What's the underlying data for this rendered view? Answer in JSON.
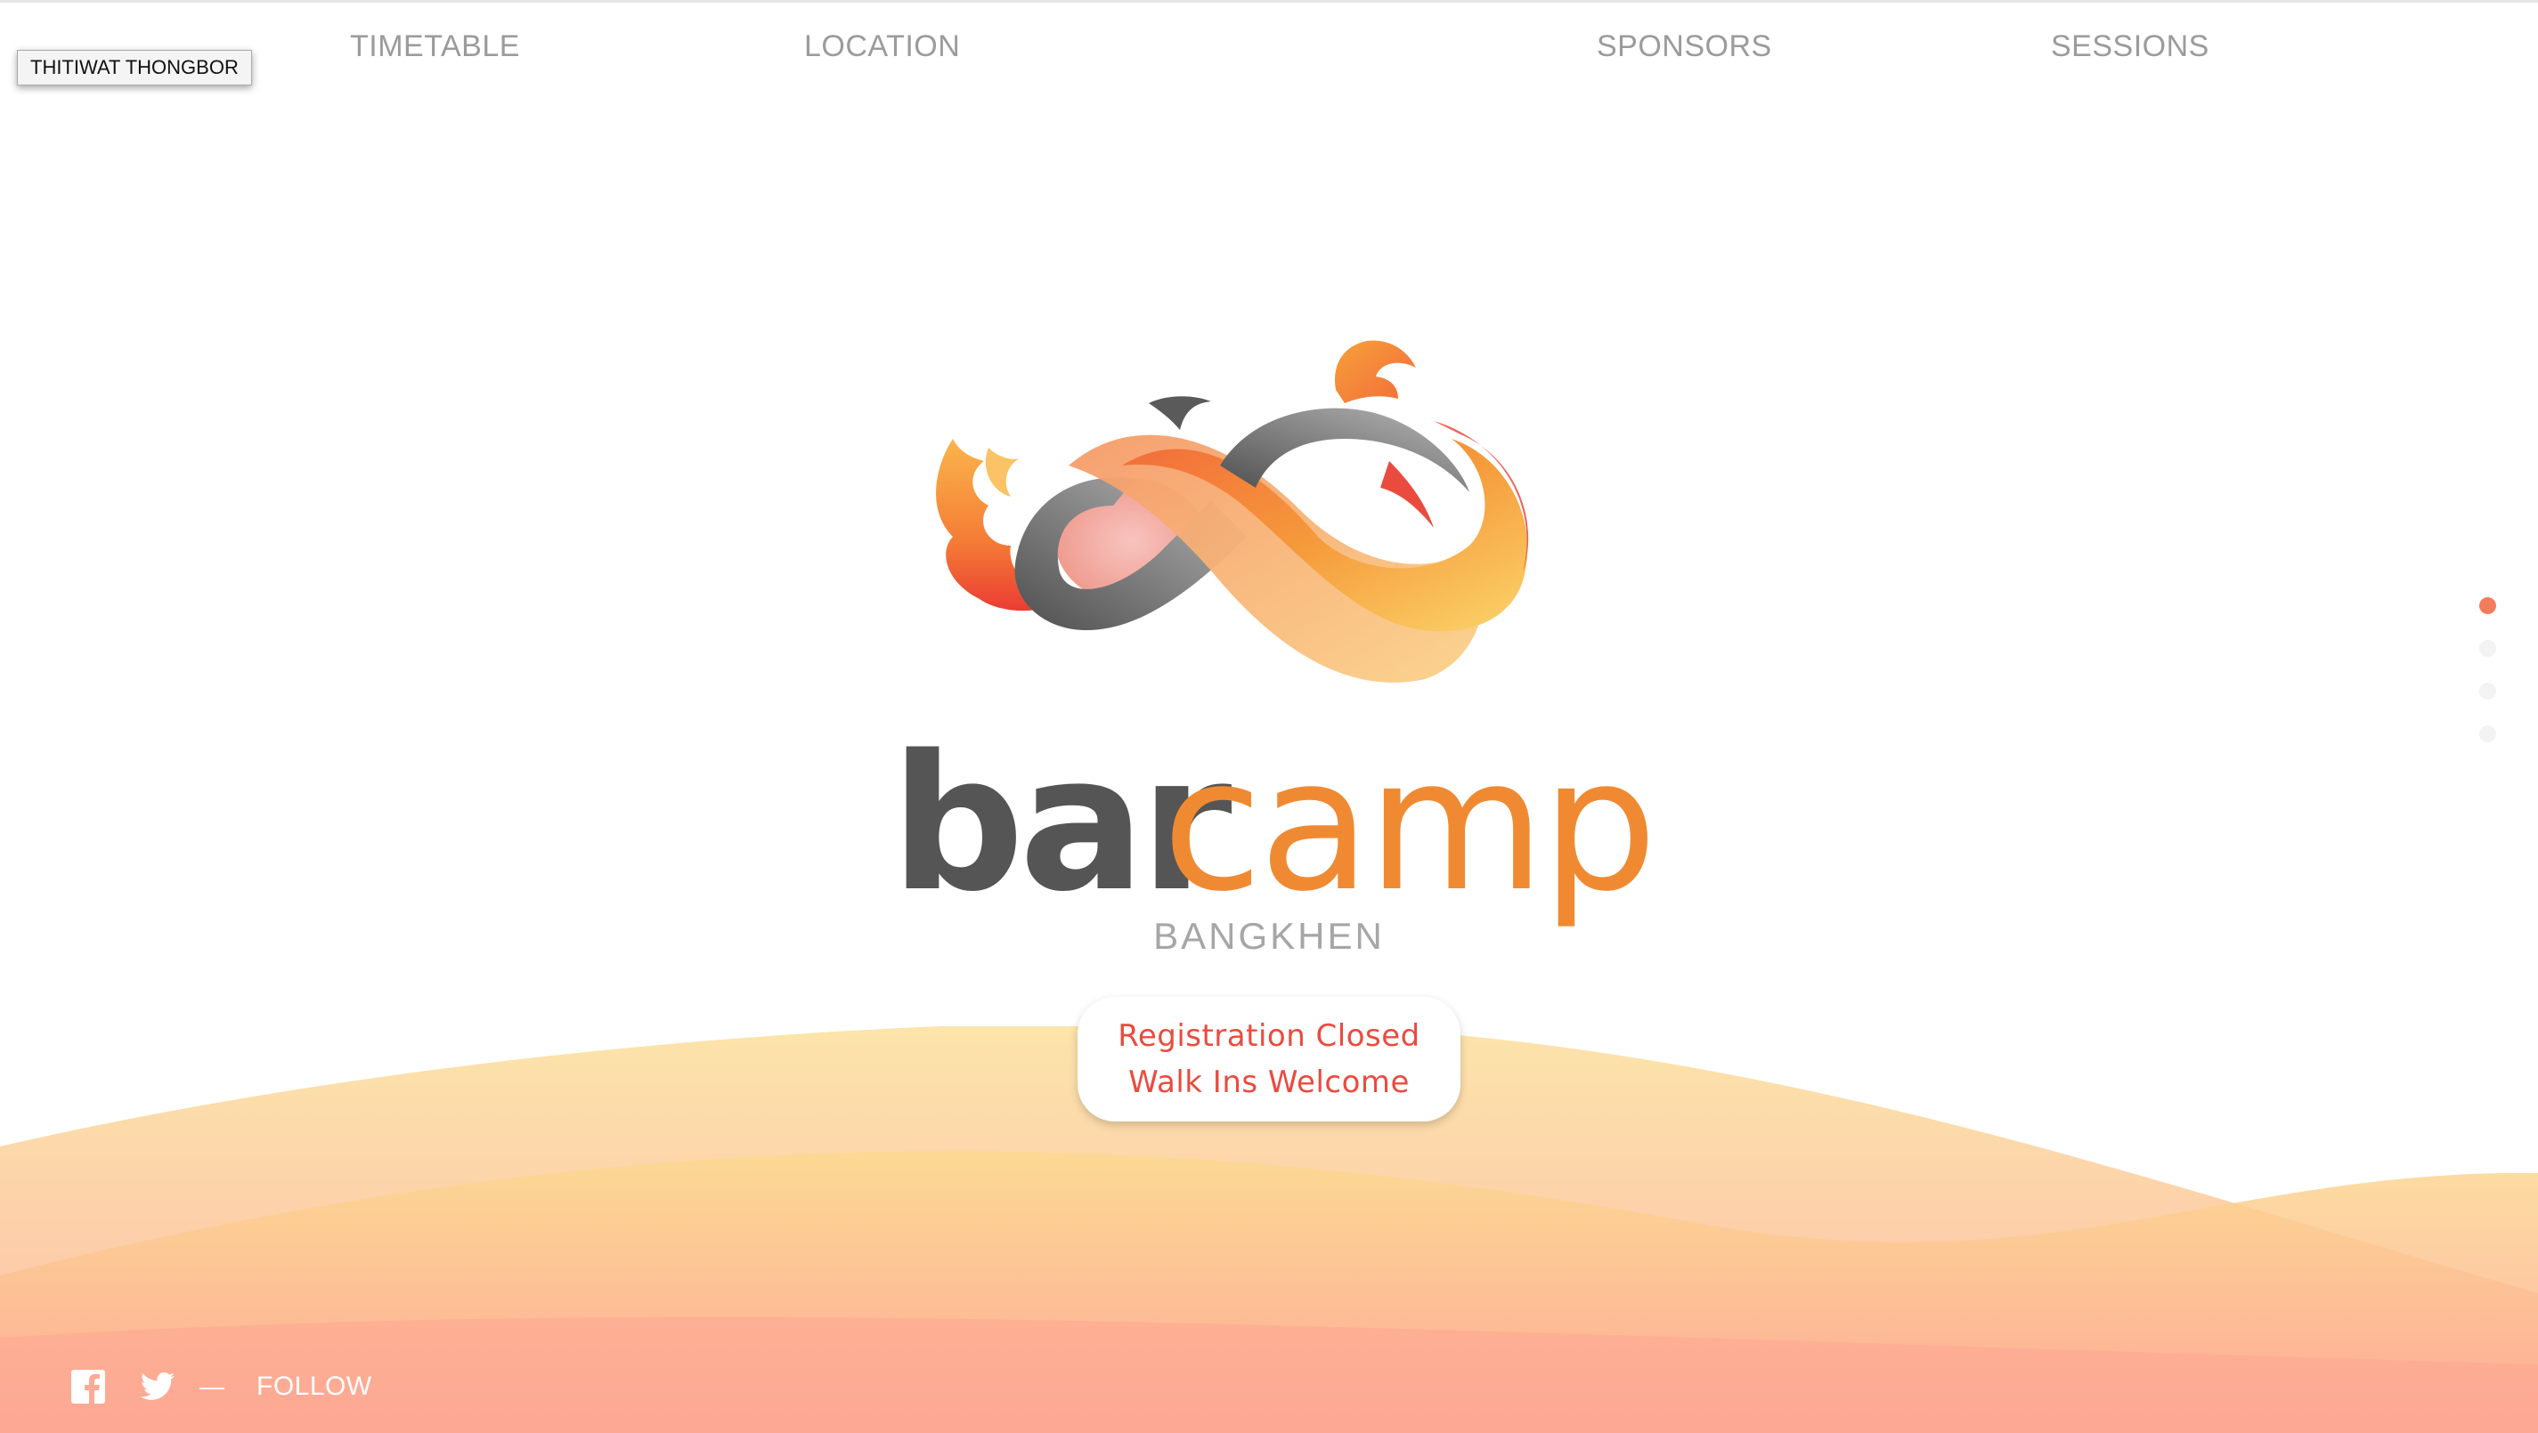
{
  "nav": {
    "items": [
      {
        "label": "TIMETABLE"
      },
      {
        "label": "LOCATION"
      },
      {
        "label": "SPONSORS"
      },
      {
        "label": "SESSIONS"
      }
    ]
  },
  "user_badge": "THITIWAT THONGBOR",
  "hero": {
    "wordmark_dark": "bar",
    "wordmark_accent": "camp",
    "subtitle": "BANGKHEN"
  },
  "registration": {
    "line1": "Registration Closed",
    "line2": "Walk Ins Welcome"
  },
  "page_dots": {
    "count": 4,
    "active_index": 0
  },
  "social": {
    "icons": [
      "facebook-icon",
      "twitter-icon"
    ],
    "separator": "—",
    "follow_label": "FOLLOW"
  },
  "colors": {
    "nav_text": "#9b9b9b",
    "wordmark_dark": "#555555",
    "wordmark_accent": "#f08a32",
    "registration_text": "#ea4b3f",
    "dot_active": "#f27c5c",
    "wave_top": "#fcd990",
    "wave_bottom": "#fda694"
  }
}
